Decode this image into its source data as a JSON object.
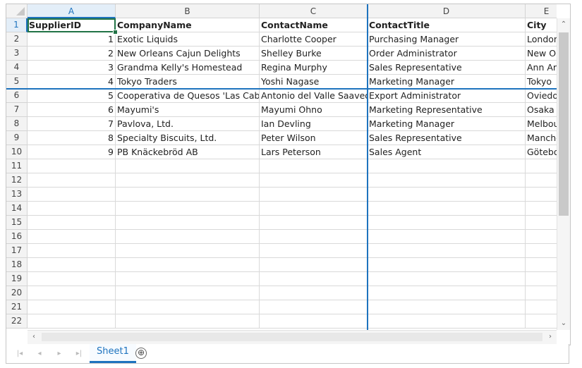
{
  "columns": [
    "A",
    "B",
    "C",
    "D",
    "E"
  ],
  "active_column": "A",
  "active_row": "1",
  "rows": [
    {
      "num": "1",
      "cells": [
        "SupplierID",
        "CompanyName",
        "ContactName",
        "ContactTitle",
        "City"
      ]
    },
    {
      "num": "2",
      "cells": [
        "1",
        "Exotic Liquids",
        "Charlotte Cooper",
        "Purchasing Manager",
        "London"
      ]
    },
    {
      "num": "3",
      "cells": [
        "2",
        "New Orleans Cajun Delights",
        "Shelley Burke",
        "Order Administrator",
        "New Orleans"
      ]
    },
    {
      "num": "4",
      "cells": [
        "3",
        "Grandma Kelly's Homestead",
        "Regina Murphy",
        "Sales Representative",
        "Ann Arbor"
      ]
    },
    {
      "num": "5",
      "cells": [
        "4",
        "Tokyo Traders",
        "Yoshi Nagase",
        "Marketing Manager",
        "Tokyo"
      ]
    },
    {
      "num": "6",
      "cells": [
        "5",
        "Cooperativa de Quesos 'Las Cabras'",
        "Antonio del Valle Saavedra",
        "Export Administrator",
        "Oviedo"
      ]
    },
    {
      "num": "7",
      "cells": [
        "6",
        "Mayumi's",
        "Mayumi Ohno",
        "Marketing Representative",
        "Osaka"
      ]
    },
    {
      "num": "8",
      "cells": [
        "7",
        "Pavlova, Ltd.",
        "Ian Devling",
        "Marketing Manager",
        "Melbourne"
      ]
    },
    {
      "num": "9",
      "cells": [
        "8",
        "Specialty Biscuits, Ltd.",
        "Peter Wilson",
        "Sales Representative",
        "Manchester"
      ]
    },
    {
      "num": "10",
      "cells": [
        "9",
        "PB Knäckebröd AB",
        "Lars Peterson",
        "Sales Agent",
        "Göteborg"
      ]
    },
    {
      "num": "11",
      "cells": [
        "",
        "",
        "",
        "",
        ""
      ]
    },
    {
      "num": "12",
      "cells": [
        "",
        "",
        "",
        "",
        ""
      ]
    },
    {
      "num": "13",
      "cells": [
        "",
        "",
        "",
        "",
        ""
      ]
    },
    {
      "num": "14",
      "cells": [
        "",
        "",
        "",
        "",
        ""
      ]
    },
    {
      "num": "15",
      "cells": [
        "",
        "",
        "",
        "",
        ""
      ]
    },
    {
      "num": "16",
      "cells": [
        "",
        "",
        "",
        "",
        ""
      ]
    },
    {
      "num": "17",
      "cells": [
        "",
        "",
        "",
        "",
        ""
      ]
    },
    {
      "num": "18",
      "cells": [
        "",
        "",
        "",
        "",
        ""
      ]
    },
    {
      "num": "19",
      "cells": [
        "",
        "",
        "",
        "",
        ""
      ]
    },
    {
      "num": "20",
      "cells": [
        "",
        "",
        "",
        "",
        ""
      ]
    },
    {
      "num": "21",
      "cells": [
        "",
        "",
        "",
        "",
        ""
      ]
    },
    {
      "num": "22",
      "cells": [
        "",
        "",
        "",
        "",
        ""
      ]
    }
  ],
  "sheet_tabs": [
    "Sheet1"
  ],
  "add_sheet_icon": "⊕",
  "icons": {
    "first_sheet": "first-sheet-icon",
    "prev_sheet": "prev-sheet-icon",
    "next_sheet": "next-sheet-icon",
    "last_sheet": "last-sheet-icon",
    "add_sheet": "add-sheet-icon",
    "scroll_up": "chevron-up-icon",
    "scroll_down": "chevron-down-icon",
    "scroll_left": "chevron-left-icon",
    "scroll_right": "chevron-right-icon"
  },
  "colors": {
    "accent": "#1e73be",
    "selection": "#217346"
  }
}
